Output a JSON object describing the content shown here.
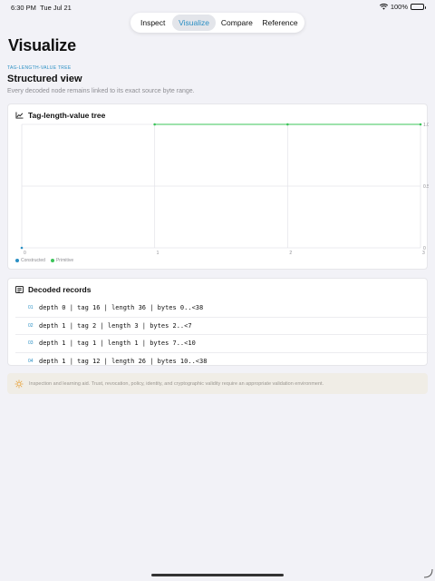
{
  "status": {
    "time": "6:30 PM",
    "date": "Tue Jul 21",
    "battery": "100%",
    "battery_level": 1.0
  },
  "tabs": [
    {
      "label": "Inspect",
      "active": false
    },
    {
      "label": "Visualize",
      "active": true
    },
    {
      "label": "Compare",
      "active": false
    },
    {
      "label": "Reference",
      "active": false
    }
  ],
  "page": {
    "title": "Visualize",
    "eyebrow": "TAG-LENGTH-VALUE TREE",
    "section_title": "Structured view",
    "section_desc": "Every decoded node remains linked to its exact source byte range."
  },
  "chart_card": {
    "title": "Tag-length-value tree",
    "icon": "chart-line-icon"
  },
  "chart_data": {
    "type": "scatter",
    "x_ticks": [
      "0",
      "1",
      "2",
      "3"
    ],
    "y_ticks": [
      "0",
      "0.5",
      "1.0"
    ],
    "xlim": [
      0,
      3
    ],
    "ylim": [
      0,
      1
    ],
    "grid": true,
    "legend_position": "bottom-left",
    "series": [
      {
        "name": "Constructed",
        "color": "#2a8fc4",
        "points": [
          [
            0,
            0
          ]
        ]
      },
      {
        "name": "Primitive",
        "color": "#3cc45a",
        "points": [
          [
            1,
            1
          ],
          [
            2,
            1
          ],
          [
            3,
            1
          ]
        ],
        "connected": true
      }
    ]
  },
  "records_card": {
    "title": "Decoded records",
    "icon": "list-icon"
  },
  "records": [
    {
      "index": "01",
      "text": "depth 0 | tag 16 | length 36 | bytes 0..<38"
    },
    {
      "index": "02",
      "text": "depth 1 | tag 2 | length 3 | bytes 2..<7"
    },
    {
      "index": "03",
      "text": "depth 1 | tag 1 | length 1 | bytes 7..<10"
    },
    {
      "index": "04",
      "text": "depth 1 | tag 12 | length 26 | bytes 10..<38"
    }
  ],
  "notice": {
    "icon": "sun-icon",
    "color": "#e8a33a",
    "text": "Inspection and learning aid. Trust, revocation, policy, identity, and cryptographic validity require an appropriate validation environment."
  }
}
